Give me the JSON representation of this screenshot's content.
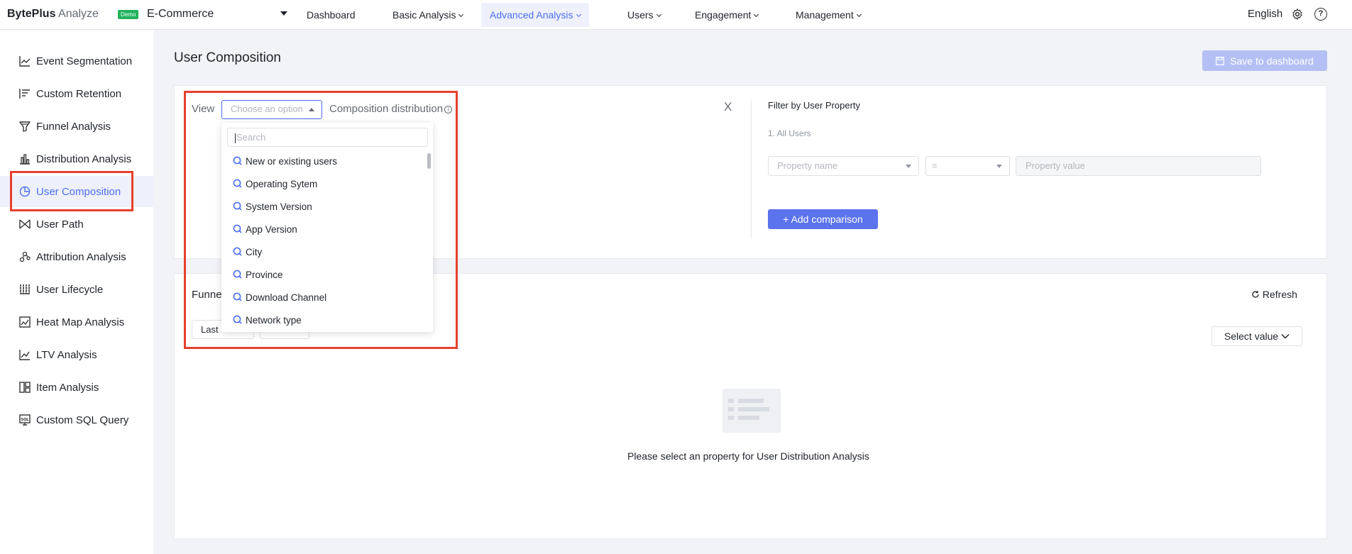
{
  "topbar": {
    "brand_bold": "BytePlus",
    "brand_sub": " Analyze",
    "demo_badge": "Demo",
    "project": "E-Commerce",
    "nav": [
      {
        "label": "Dashboard",
        "dropdown": false
      },
      {
        "label": "Basic Analysis",
        "dropdown": true
      },
      {
        "label": "Advanced Analysis",
        "dropdown": true
      },
      {
        "label": "Users",
        "dropdown": true
      },
      {
        "label": "Engagement",
        "dropdown": true
      },
      {
        "label": "Management",
        "dropdown": true
      }
    ],
    "language": "English"
  },
  "sidebar": {
    "items": [
      {
        "label": "Event Segmentation",
        "icon": "line-chart-icon"
      },
      {
        "label": "Custom Retention",
        "icon": "retention-icon"
      },
      {
        "label": "Funnel Analysis",
        "icon": "funnel-icon"
      },
      {
        "label": "Distribution Analysis",
        "icon": "bar-chart-icon"
      },
      {
        "label": "User Composition",
        "icon": "pie-chart-icon"
      },
      {
        "label": "User Path",
        "icon": "path-icon"
      },
      {
        "label": "Attribution Analysis",
        "icon": "attribution-icon"
      },
      {
        "label": "User Lifecycle",
        "icon": "lifecycle-icon"
      },
      {
        "label": "Heat Map Analysis",
        "icon": "heatmap-icon"
      },
      {
        "label": "LTV Analysis",
        "icon": "ltv-icon"
      },
      {
        "label": "Item Analysis",
        "icon": "item-icon"
      },
      {
        "label": "Custom SQL Query",
        "icon": "sql-icon"
      }
    ],
    "active_index": 4
  },
  "main": {
    "title": "User Composition",
    "save_label": "Save to dashboard",
    "view_label": "View",
    "view_placeholder": "Choose an option",
    "composition_label": "Composition distribution",
    "close_label": "X",
    "filter_title": "Filter by User Property",
    "all_users": "1. All Users",
    "property_name_placeholder": "Property name",
    "operator": "=",
    "property_value_placeholder": "Property value",
    "add_comparison": "Add comparison",
    "funnel_label": "Funne",
    "last_label": "Last",
    "refresh_label": "Refresh",
    "select_value": "Select value",
    "empty_message": "Please select an property for User Distribution Analysis"
  },
  "dropdown": {
    "search_placeholder": "Search",
    "options": [
      "New or existing users",
      "Operating Sytem",
      "System Version",
      "App Version",
      "City",
      "Province",
      "Download Channel",
      "Network type"
    ]
  },
  "colors": {
    "accent": "#4e6ef2",
    "highlight": "#e5412d",
    "demo_badge": "#22b35e",
    "add_button": "#5b73ec"
  }
}
